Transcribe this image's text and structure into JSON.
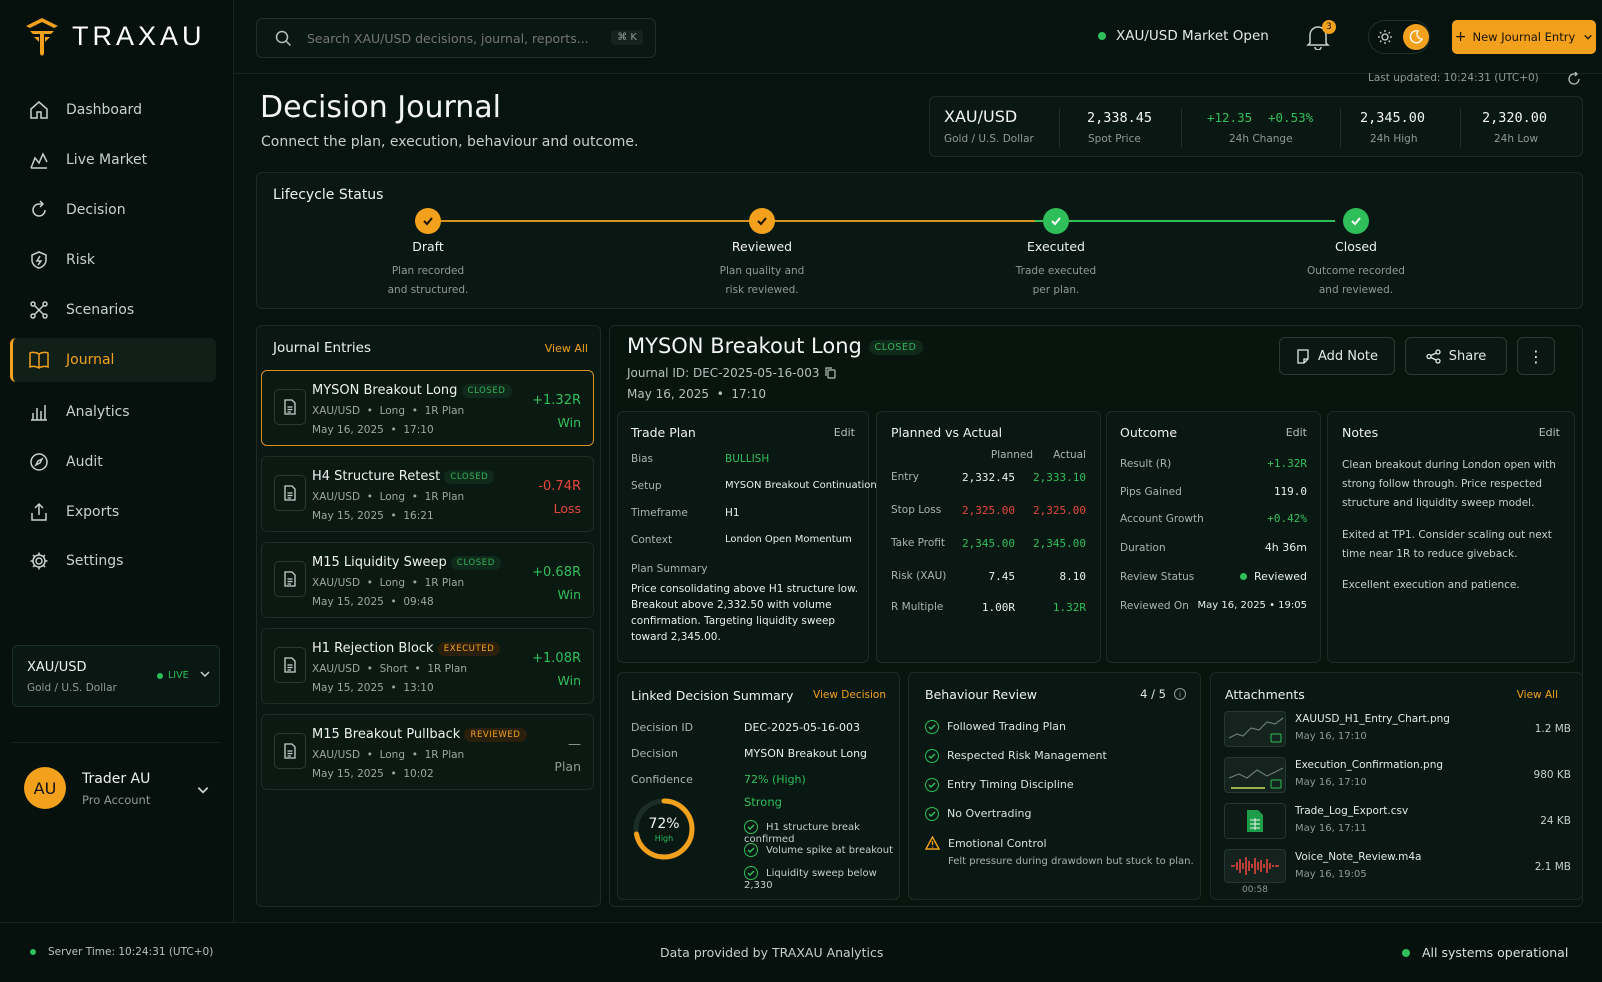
{
  "brand": {
    "name": "TRAXAU"
  },
  "colors": {
    "accent": "#f3a11d",
    "success": "#2fbf5a",
    "danger": "#e5473d",
    "bg": "#07130f"
  },
  "nav": [
    {
      "label": "Dashboard",
      "icon": "home-icon"
    },
    {
      "label": "Live Market",
      "icon": "chart-line-icon"
    },
    {
      "label": "Decision",
      "icon": "refresh-icon"
    },
    {
      "label": "Risk",
      "icon": "shield-icon"
    },
    {
      "label": "Scenarios",
      "icon": "branch-icon"
    },
    {
      "label": "Journal",
      "icon": "book-icon",
      "active": true
    },
    {
      "label": "Analytics",
      "icon": "bar-chart-icon"
    },
    {
      "label": "Audit",
      "icon": "compass-icon"
    },
    {
      "label": "Exports",
      "icon": "upload-icon"
    },
    {
      "label": "Settings",
      "icon": "gear-icon"
    }
  ],
  "instrument_card": {
    "symbol": "XAU/USD",
    "name": "Gold / U.S. Dollar",
    "status": "LIVE"
  },
  "user": {
    "initials": "AU",
    "name": "Trader AU",
    "plan": "Pro Account"
  },
  "search": {
    "placeholder": "Search XAU/USD decisions, journal, reports...",
    "shortcut": "⌘ K"
  },
  "market_status": "XAU/USD Market Open",
  "notifications": {
    "count": "3"
  },
  "new_entry_label": "New Journal Entry",
  "last_updated": "Last updated: 10:24:31 (UTC+0)",
  "page": {
    "title": "Decision Journal",
    "subtitle": "Connect the plan, execution, behaviour and outcome."
  },
  "ticker": {
    "symbol": "XAU/USD",
    "name": "Gold / U.S. Dollar",
    "spot": "2,338.45",
    "spot_label": "Spot Price",
    "change_abs": "+12.35",
    "change_pct": "+0.53%",
    "change_label": "24h Change",
    "high": "2,345.00",
    "high_label": "24h High",
    "low": "2,320.00",
    "low_label": "24h Low"
  },
  "lifecycle": {
    "title": "Lifecycle Status",
    "steps": [
      {
        "name": "Draft",
        "l1": "Plan recorded",
        "l2": "and structured."
      },
      {
        "name": "Reviewed",
        "l1": "Plan quality and",
        "l2": "risk reviewed."
      },
      {
        "name": "Executed",
        "l1": "Trade executed",
        "l2": "per plan."
      },
      {
        "name": "Closed",
        "l1": "Outcome recorded",
        "l2": "and reviewed."
      }
    ]
  },
  "journal": {
    "title": "Journal Entries",
    "view_all": "View All",
    "entries": [
      {
        "title": "MYSON Breakout Long",
        "tag": "CLOSED",
        "pair": "XAU/USD",
        "side": "Long",
        "plan": "1R Plan",
        "date": "May 16, 2025",
        "time": "17:10",
        "result": "+1.32R",
        "outcome": "Win"
      },
      {
        "title": "H4 Structure Retest",
        "tag": "CLOSED",
        "pair": "XAU/USD",
        "side": "Long",
        "plan": "1R Plan",
        "date": "May 15, 2025",
        "time": "16:21",
        "result": "-0.74R",
        "outcome": "Loss"
      },
      {
        "title": "M15 Liquidity Sweep",
        "tag": "CLOSED",
        "pair": "XAU/USD",
        "side": "Long",
        "plan": "1R Plan",
        "date": "May 15, 2025",
        "time": "09:48",
        "result": "+0.68R",
        "outcome": "Win"
      },
      {
        "title": "H1 Rejection Block",
        "tag": "EXECUTED",
        "pair": "XAU/USD",
        "side": "Short",
        "plan": "1R Plan",
        "date": "May 15, 2025",
        "time": "13:10",
        "result": "+1.08R",
        "outcome": "Win"
      },
      {
        "title": "M15 Breakout Pullback",
        "tag": "REVIEWED",
        "pair": "XAU/USD",
        "side": "Long",
        "plan": "1R Plan",
        "date": "May 15, 2025",
        "time": "10:02",
        "result": "—",
        "outcome": "Plan"
      }
    ]
  },
  "detail": {
    "title": "MYSON Breakout Long",
    "tag": "CLOSED",
    "journal_id": "Journal ID: DEC-2025-05-16-003",
    "date": "May 16, 2025",
    "time": "17:10",
    "add_note": "Add Note",
    "share": "Share"
  },
  "trade_plan": {
    "title": "Trade Plan",
    "edit": "Edit",
    "bias_label": "Bias",
    "bias": "BULLISH",
    "setup_label": "Setup",
    "setup": "MYSON Breakout Continuation",
    "tf_label": "Timeframe",
    "tf": "H1",
    "context_label": "Context",
    "context": "London Open Momentum",
    "summary_label": "Plan Summary",
    "summary": "Price consolidating above H1 structure low. Breakout above 2,332.50 with volume confirmation. Targeting liquidity sweep toward 2,345.00."
  },
  "pva": {
    "title": "Planned vs Actual",
    "planned": "Planned",
    "actual": "Actual",
    "rows": [
      {
        "label": "Entry",
        "p": "2,332.45",
        "a": "2,333.10"
      },
      {
        "label": "Stop Loss",
        "p": "2,325.00",
        "a": "2,325.00"
      },
      {
        "label": "Take Profit",
        "p": "2,345.00",
        "a": "2,345.00"
      },
      {
        "label": "Risk (XAU)",
        "p": "7.45",
        "a": "8.10"
      },
      {
        "label": "R Multiple",
        "p": "1.00R",
        "a": "1.32R"
      }
    ]
  },
  "outcome": {
    "title": "Outcome",
    "edit": "Edit",
    "rows": [
      {
        "label": "Result (R)",
        "value": "+1.32R"
      },
      {
        "label": "Pips Gained",
        "value": "119.0"
      },
      {
        "label": "Account Growth",
        "value": "+0.42%"
      },
      {
        "label": "Duration",
        "value": "4h 36m"
      },
      {
        "label": "Review Status",
        "value": "Reviewed"
      },
      {
        "label": "Reviewed On",
        "value": "May 16, 2025 • 19:05"
      }
    ]
  },
  "notes": {
    "title": "Notes",
    "edit": "Edit",
    "p1": "Clean breakout during London open with strong follow through. Price respected structure and liquidity sweep model.",
    "p2": "Exited at TP1. Consider scaling out next time near 1R to reduce giveback.",
    "p3": "Excellent execution and patience."
  },
  "linked": {
    "title": "Linked Decision Summary",
    "view": "View Decision",
    "id_label": "Decision ID",
    "id": "DEC-2025-05-16-003",
    "dec_label": "Decision",
    "dec": "MYSON Breakout Long",
    "conf_label": "Confidence",
    "conf": "72% (High)",
    "conf_word": "Strong",
    "gauge_value": "72%",
    "gauge_label": "High",
    "gauge_fraction": 0.72,
    "checks": [
      "H1 structure break confirmed",
      "Volume spike at breakout",
      "Liquidity sweep below 2,330"
    ]
  },
  "behaviour": {
    "title": "Behaviour Review",
    "score": "4 / 5",
    "items": [
      "Followed Trading Plan",
      "Respected Risk Management",
      "Entry Timing Discipline",
      "No Overtrading"
    ],
    "warn": "Emotional Control",
    "warn_note": "Felt pressure during drawdown but stuck to plan."
  },
  "attachments": {
    "title": "Attachments",
    "view_all": "View All",
    "files": [
      {
        "name": "XAUUSD_H1_Entry_Chart.png",
        "date": "May 16, 17:10",
        "size": "1.2 MB"
      },
      {
        "name": "Execution_Confirmation.png",
        "date": "May 16, 17:10",
        "size": "980 KB"
      },
      {
        "name": "Trade_Log_Export.csv",
        "date": "May 16, 17:11",
        "size": "24 KB"
      },
      {
        "name": "Voice_Note_Review.m4a",
        "date": "May 16, 19:05",
        "size": "2.1 MB",
        "duration": "00:58"
      }
    ]
  },
  "footer": {
    "server": "Server Time: 10:24:31 (UTC+0)",
    "provider": "Data provided by TRAXAU Analytics",
    "status": "All systems operational"
  }
}
